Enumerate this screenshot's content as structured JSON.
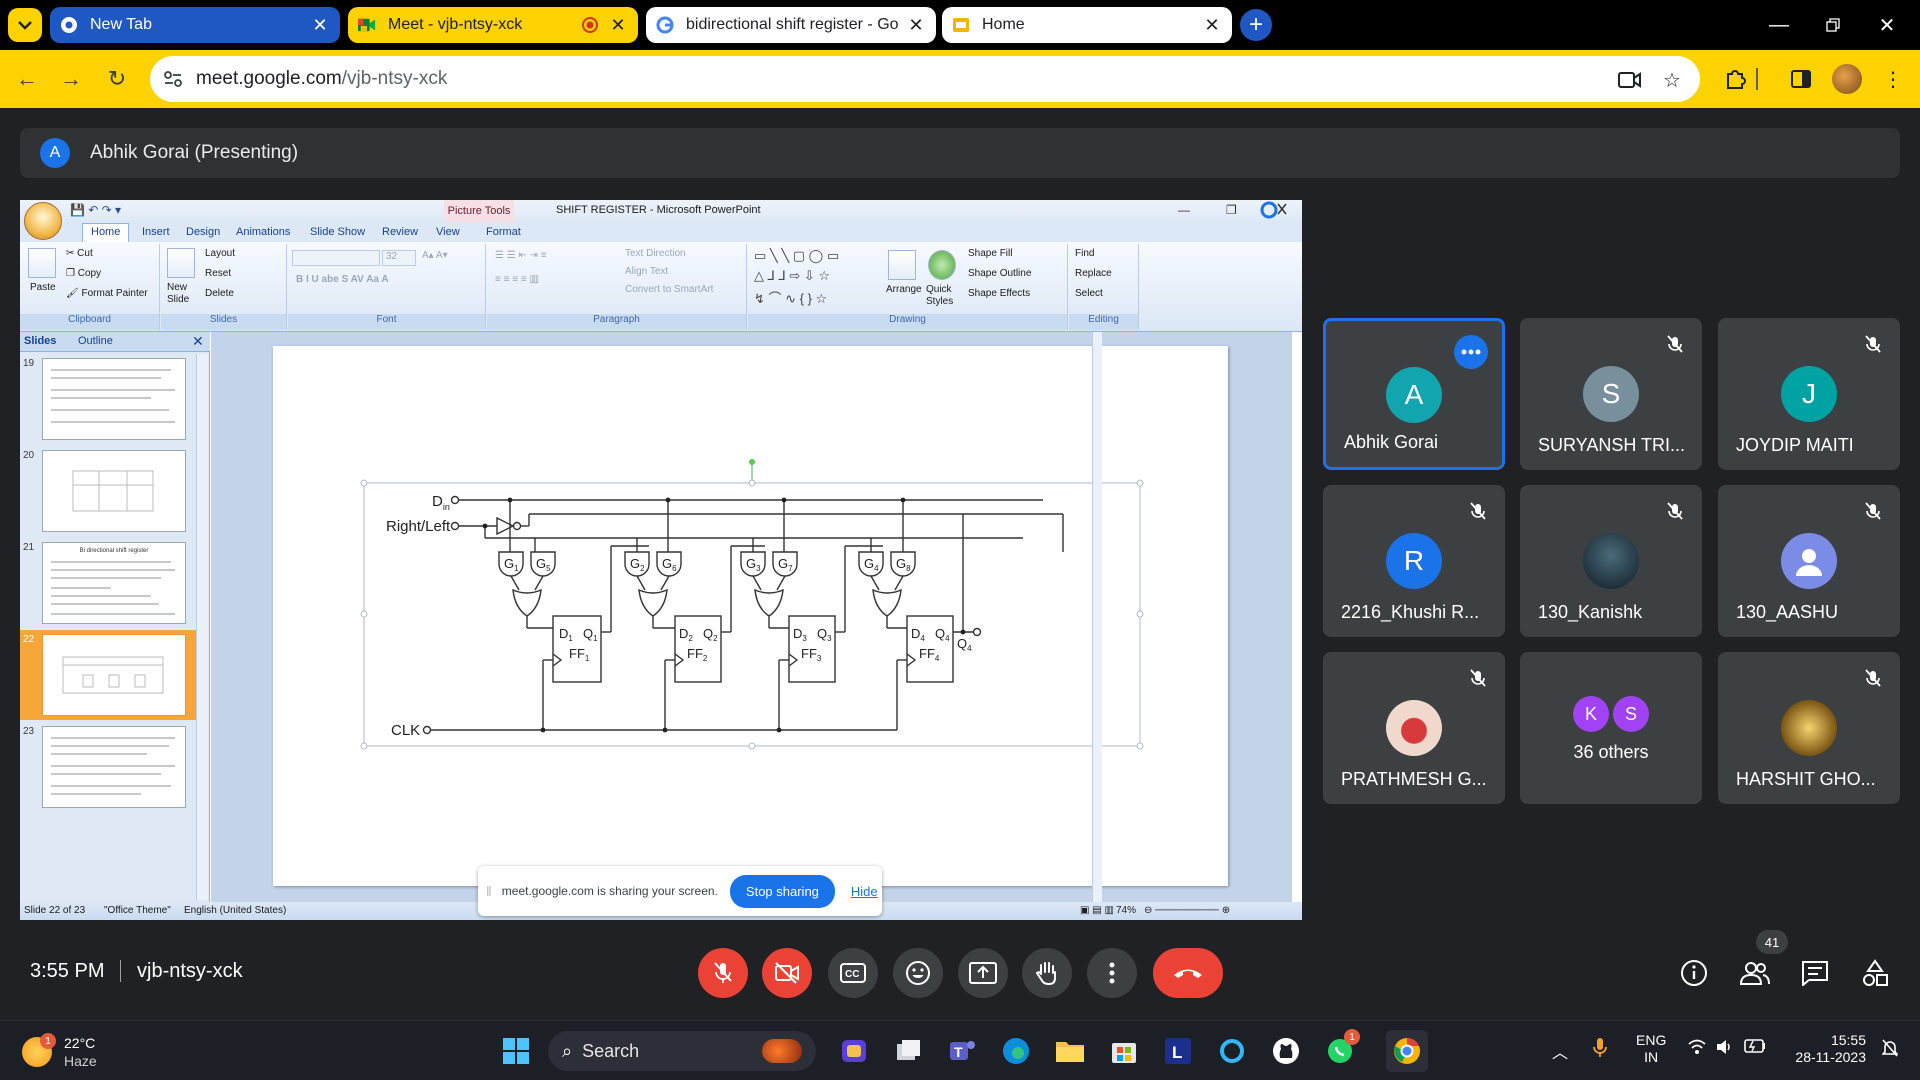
{
  "browser": {
    "tabs": [
      {
        "title": "New Tab"
      },
      {
        "title": "Meet - vjb-ntsy-xck"
      },
      {
        "title": "bidirectional shift register - Go"
      },
      {
        "title": "Home"
      }
    ],
    "url_host": "meet.google.com",
    "url_path": "/vjb-ntsy-xck"
  },
  "meet": {
    "presenter_initial": "A",
    "presenting_label": "Abhik Gorai (Presenting)",
    "time": "3:55 PM",
    "meeting_code": "vjb-ntsy-xck",
    "people_count": "41",
    "participants": [
      {
        "initial": "A",
        "name": "Abhik Gorai",
        "color": "#12a4af"
      },
      {
        "initial": "S",
        "name": "SURYANSH TRI...",
        "color": "#78909c"
      },
      {
        "initial": "J",
        "name": "JOYDIP MAITI",
        "color": "#00a3a3"
      },
      {
        "initial": "R",
        "name": "2216_Khushi R...",
        "color": "#1a73e8"
      },
      {
        "initial": "",
        "name": "130_Kanishk",
        "color": "#1e3340"
      },
      {
        "initial": "",
        "name": "130_AASHU",
        "color": "#7b8ce6"
      },
      {
        "initial": "",
        "name": "PRATHMESH G...",
        "color": "#e8d7d0"
      },
      {
        "initial": "",
        "name": "36 others",
        "color": "#a142f4"
      },
      {
        "initial": "",
        "name": "HARSHIT GHO...",
        "color": "#b8862a"
      }
    ],
    "others_initials": [
      "K",
      "S"
    ],
    "share_notice": {
      "message": "meet.google.com is sharing your screen.",
      "stop": "Stop sharing",
      "hide": "Hide"
    }
  },
  "powerpoint": {
    "context_tab": "Picture Tools",
    "doc_title": "SHIFT REGISTER - Microsoft PowerPoint",
    "ribbon_tabs": [
      "Home",
      "Insert",
      "Design",
      "Animations",
      "Slide Show",
      "Review",
      "View",
      "Format"
    ],
    "clipboard": {
      "paste": "Paste",
      "cut": "Cut",
      "copy": "Copy",
      "format_painter": "Format Painter",
      "label": "Clipboard"
    },
    "slides_group": {
      "new_slide": "New Slide",
      "layout": "Layout",
      "reset": "Reset",
      "delete": "Delete",
      "label": "Slides"
    },
    "font_group": {
      "size": "32",
      "label": "Font"
    },
    "paragraph_group": {
      "text_direction": "Text Direction",
      "align_text": "Align Text",
      "convert": "Convert to SmartArt",
      "label": "Paragraph"
    },
    "drawing_group": {
      "arrange": "Arrange",
      "quick_styles": "Quick Styles",
      "shape_fill": "Shape Fill",
      "shape_outline": "Shape Outline",
      "shape_effects": "Shape Effects",
      "label": "Drawing"
    },
    "editing_group": {
      "find": "Find",
      "replace": "Replace",
      "select": "Select",
      "label": "Editing"
    },
    "pane_tabs": {
      "slides": "Slides",
      "outline": "Outline"
    },
    "thumbnails": [
      {
        "num": "19"
      },
      {
        "num": "20"
      },
      {
        "num": "21",
        "title": "Bi directional shift register"
      },
      {
        "num": "22"
      },
      {
        "num": "23"
      }
    ],
    "status": {
      "slide": "Slide 22 of 23",
      "theme": "\"Office Theme\"",
      "language": "English (United States)",
      "zoom": "74%"
    }
  },
  "circuit": {
    "din": "D",
    "din_sub": "in",
    "right_left": "Right/Left",
    "clk": "CLK",
    "gates": [
      [
        "G",
        "1"
      ],
      [
        "G",
        "5"
      ],
      [
        "G",
        "2"
      ],
      [
        "G",
        "6"
      ],
      [
        "G",
        "3"
      ],
      [
        "G",
        "7"
      ],
      [
        "G",
        "4"
      ],
      [
        "G",
        "8"
      ]
    ],
    "flipflops": [
      {
        "d": "D",
        "q": "Q",
        "ff": "FF",
        "n": "1"
      },
      {
        "d": "D",
        "q": "Q",
        "ff": "FF",
        "n": "2"
      },
      {
        "d": "D",
        "q": "Q",
        "ff": "FF",
        "n": "3"
      },
      {
        "d": "D",
        "q": "Q",
        "ff": "FF",
        "n": "4"
      }
    ],
    "output": "Q",
    "output_sub": "4"
  },
  "taskbar": {
    "temp": "22°C",
    "condition": "Haze",
    "weather_badge": "1",
    "search": "Search",
    "whatsapp_badge": "1",
    "lang1": "ENG",
    "lang2": "IN",
    "time": "15:55",
    "date": "28-11-2023"
  }
}
